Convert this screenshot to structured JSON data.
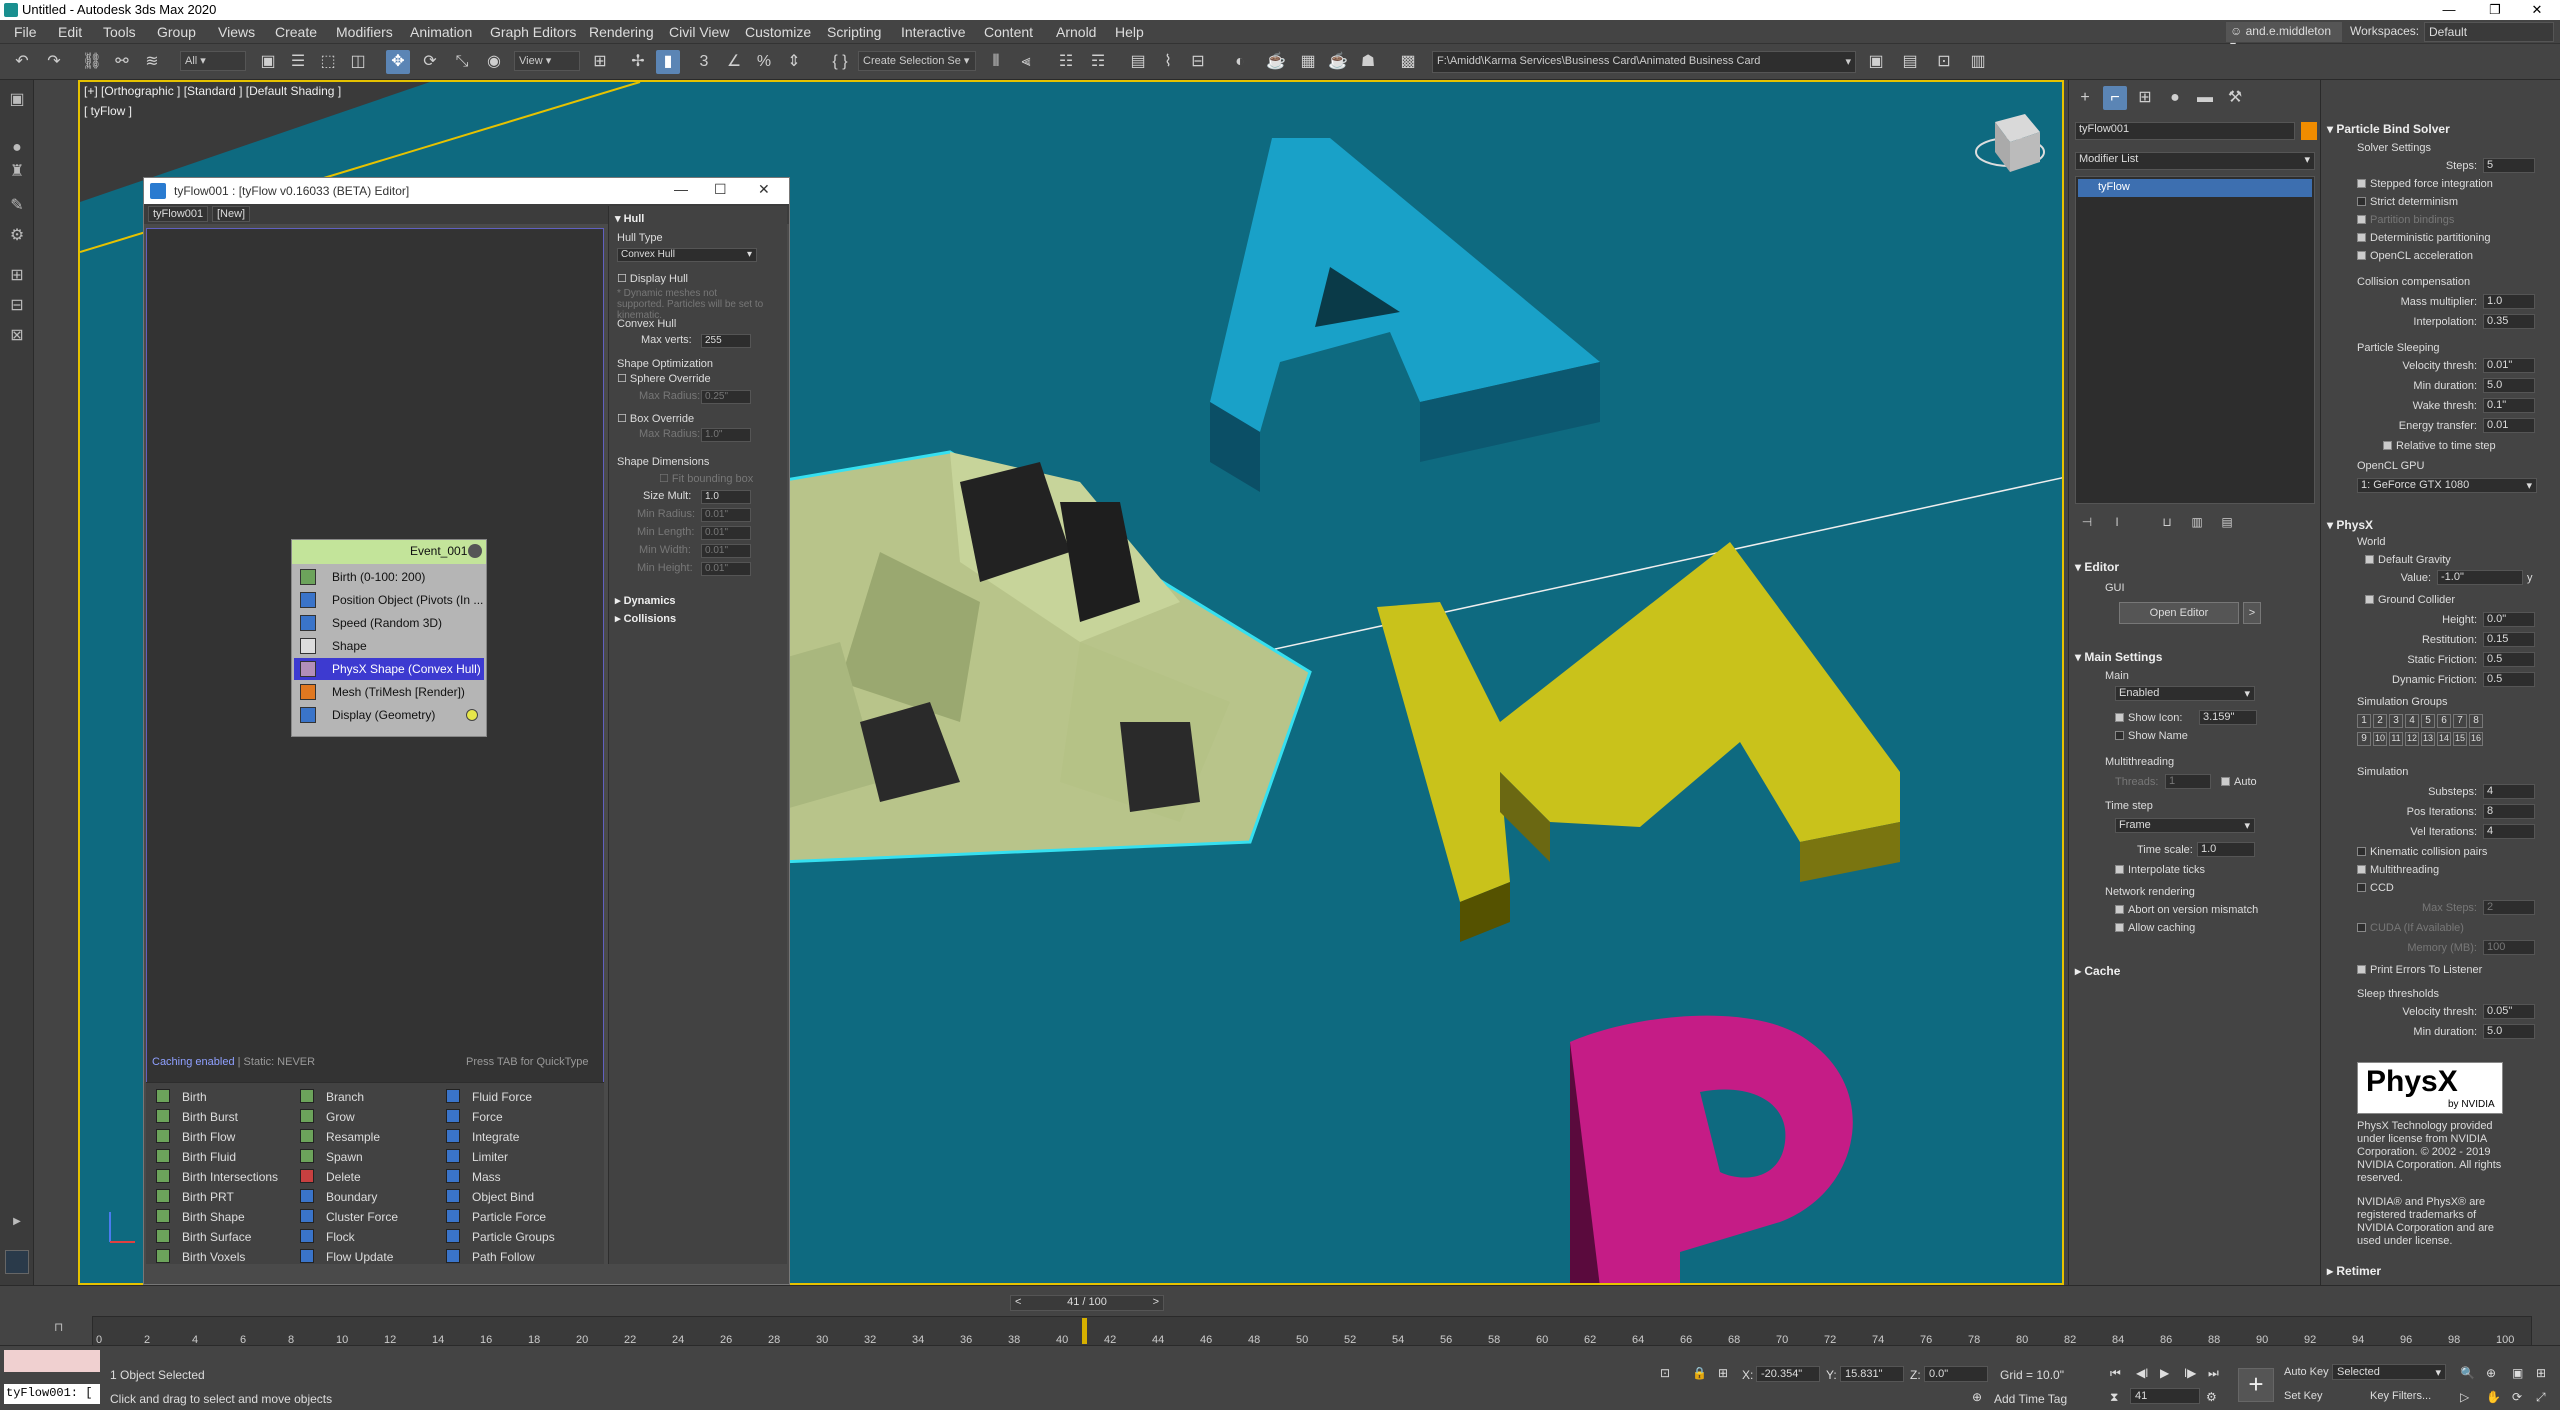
{
  "window": {
    "title": "Untitled - Autodesk 3ds Max 2020",
    "min": "—",
    "max": "❐",
    "close": "✕"
  },
  "menu": [
    "File",
    "Edit",
    "Tools",
    "Group",
    "Views",
    "Create",
    "Modifiers",
    "Animation",
    "Graph Editors",
    "Rendering",
    "Civil View",
    "Customize",
    "Scripting",
    "Interactive",
    "Content",
    "Arnold",
    "Help"
  ],
  "user": "and.e.middleton",
  "workspaces_label": "Workspaces:",
  "workspaces_value": "Default",
  "toolbar": {
    "selection_filter": "All",
    "ref_coord": "View",
    "named_selection": "Create Selection Se",
    "project_path": "F:\\Amidd\\Karma Services\\Business Card\\Animated Business Card"
  },
  "viewport": {
    "label": "[+] [Orthographic ] [Standard ] [Default Shading ]",
    "object_label": "[ tyFlow ]",
    "letters": [
      "A",
      "M",
      "P"
    ]
  },
  "editor": {
    "title": "tyFlow001 : [tyFlow v0.16033 (BETA) Editor]",
    "tabs": [
      "tyFlow001",
      "[New]"
    ],
    "status_left": "Caching enabled",
    "status_static": "| Static: NEVER",
    "status_right": "Press TAB for QuickType",
    "event": {
      "name": "Event_001",
      "operators": [
        "Birth (0-100: 200)",
        "Position Object (Pivots (In ...",
        "Speed (Random 3D)",
        "Shape",
        "PhysX Shape (Convex Hull)",
        "Mesh (TriMesh [Render])",
        "Display (Geometry)"
      ],
      "selected_index": 4
    },
    "hull": {
      "header": "Hull",
      "hull_type_label": "Hull Type",
      "hull_type_value": "Convex Hull",
      "display_hull": "Display Hull",
      "note": "* Dynamic meshes not supported. Particles will be set to kinematic.",
      "convex_hull_label": "Convex Hull",
      "max_verts_label": "Max verts:",
      "max_verts_value": "255",
      "shape_opt_label": "Shape Optimization",
      "sphere_override": "Sphere Override",
      "max_radius_label": "Max Radius:",
      "max_radius_value": "0.25\"",
      "box_override": "Box Override",
      "max_radius2_value": "1.0\"",
      "shape_dims_label": "Shape Dimensions",
      "fit_bbox": "Fit bounding box",
      "size_mult_label": "Size Mult:",
      "size_mult_value": "1.0",
      "min_radius_label": "Min Radius:",
      "min_radius_value": "0.01\"",
      "min_length_label": "Min Length:",
      "min_length_value": "0.01\"",
      "min_width_label": "Min Width:",
      "min_width_value": "0.01\"",
      "min_height_label": "Min Height:",
      "min_height_value": "0.01\"",
      "dynamics": "Dynamics",
      "collisions": "Collisions"
    },
    "palette": [
      [
        "Birth",
        "Branch",
        "Fluid Force"
      ],
      [
        "Birth Burst",
        "Grow",
        "Force"
      ],
      [
        "Birth Flow",
        "Resample",
        "Integrate"
      ],
      [
        "Birth Fluid",
        "Spawn",
        "Limiter"
      ],
      [
        "Birth Intersections",
        "Delete",
        "Mass"
      ],
      [
        "Birth PRT",
        "Boundary",
        "Object Bind"
      ],
      [
        "Birth Shape",
        "Cluster Force",
        "Particle Force"
      ],
      [
        "Birth Surface",
        "Flock",
        "Particle Groups"
      ],
      [
        "Birth Voxels",
        "Flow Update",
        "Path Follow"
      ]
    ]
  },
  "command_panel": {
    "object_name": "tyFlow001",
    "modifier_list": "Modifier List",
    "stack_item": "tyFlow",
    "editor_header": "Editor",
    "gui_label": "GUI",
    "open_editor": "Open Editor",
    "open_arrow": ">",
    "main_settings": "Main Settings",
    "main_label": "Main",
    "enabled_value": "Enabled",
    "show_icon": "Show Icon:",
    "show_icon_value": "3.159\"",
    "show_name": "Show Name",
    "multithreading_label": "Multithreading",
    "threads_label": "Threads:",
    "threads_value": "1",
    "auto": "Auto",
    "time_step_label": "Time step",
    "time_step_value": "Frame",
    "time_scale_label": "Time scale:",
    "time_scale_value": "1.0",
    "interpolate_ticks": "Interpolate ticks",
    "network_rendering_label": "Network rendering",
    "abort_mismatch": "Abort on version mismatch",
    "allow_caching": "Allow caching",
    "cache_header": "Cache"
  },
  "solver": {
    "header": "Particle Bind Solver",
    "solver_settings": "Solver Settings",
    "steps_label": "Steps:",
    "steps_value": "5",
    "stepped_force": "Stepped force integration",
    "strict_det": "Strict determinism",
    "partition_bindings": "Partition bindings",
    "det_partitioning": "Deterministic partitioning",
    "opencl_accel": "OpenCL acceleration",
    "collision_comp": "Collision compensation",
    "mass_mult_label": "Mass multiplier:",
    "mass_mult_value": "1.0",
    "interp_label": "Interpolation:",
    "interp_value": "0.35",
    "sleeping": "Particle Sleeping",
    "vel_thresh_label": "Velocity thresh:",
    "vel_thresh_value": "0.01\"",
    "min_dur_label": "Min duration:",
    "min_dur_value": "5.0",
    "wake_thresh_label": "Wake thresh:",
    "wake_thresh_value": "0.1\"",
    "energy_label": "Energy transfer:",
    "energy_value": "0.01",
    "relative_time": "Relative to time step",
    "opencl_gpu": "OpenCL GPU",
    "gpu_value": "1: GeForce GTX 1080"
  },
  "physx": {
    "header": "PhysX",
    "world": "World",
    "default_gravity": "Default Gravity",
    "value_label": "Value:",
    "value_value": "-1.0\"",
    "value_axis": "y",
    "ground_collider": "Ground Collider",
    "height_label": "Height:",
    "height_value": "0.0\"",
    "restitution_label": "Restitution:",
    "restitution_value": "0.15",
    "static_fr_label": "Static Friction:",
    "static_fr_value": "0.5",
    "dynamic_fr_label": "Dynamic Friction:",
    "dynamic_fr_value": "0.5",
    "sim_groups": "Simulation Groups",
    "groups": [
      "1",
      "2",
      "3",
      "4",
      "5",
      "6",
      "7",
      "8",
      "9",
      "10",
      "11",
      "12",
      "13",
      "14",
      "15",
      "16"
    ],
    "simulation": "Simulation",
    "substeps_label": "Substeps:",
    "substeps_value": "4",
    "pos_iter_label": "Pos Iterations:",
    "pos_iter_value": "8",
    "vel_iter_label": "Vel Iterations:",
    "vel_iter_value": "4",
    "kinematic_pairs": "Kinematic collision pairs",
    "multithreading": "Multithreading",
    "ccd": "CCD",
    "max_steps_label": "Max Steps:",
    "max_steps_value": "2",
    "cuda": "CUDA (If Available)",
    "memory_label": "Memory (MB):",
    "memory_value": "100",
    "print_errors": "Print Errors To Listener",
    "sleep_thresholds": "Sleep thresholds",
    "sleep_vel_label": "Velocity thresh:",
    "sleep_vel_value": "0.05\"",
    "sleep_min_label": "Min duration:",
    "sleep_min_value": "5.0",
    "logo_main": "PhysX",
    "logo_sub": "by NVIDIA",
    "license1": "PhysX Technology provided under license from NVIDIA Corporation. © 2002 - 2019 NVIDIA Corporation. All rights reserved.",
    "license2": "NVIDIA® and PhysX® are registered trademarks of NVIDIA Corporation and are used under license.",
    "retimer": "Retimer"
  },
  "timeline": {
    "frame_display": "41 / 100",
    "prev": "<",
    "next": ">",
    "ticks": [
      "0",
      "2",
      "4",
      "6",
      "8",
      "10",
      "12",
      "14",
      "16",
      "18",
      "20",
      "22",
      "24",
      "26",
      "28",
      "30",
      "32",
      "34",
      "36",
      "38",
      "40",
      "42",
      "44",
      "46",
      "48",
      "50",
      "52",
      "54",
      "56",
      "58",
      "60",
      "62",
      "64",
      "66",
      "68",
      "70",
      "72",
      "74",
      "76",
      "78",
      "80",
      "82",
      "84",
      "86",
      "88",
      "90",
      "92",
      "94",
      "96",
      "98",
      "100"
    ],
    "current_frame": 41,
    "total_frames": 100
  },
  "status": {
    "script_text": "tyFlow001: [",
    "selected": "1 Object Selected",
    "prompt": "Click and drag to select and move objects",
    "x_label": "X:",
    "x_value": "-20.354\"",
    "y_label": "Y:",
    "y_value": "15.831\"",
    "z_label": "Z:",
    "z_value": "0.0\"",
    "grid": "Grid = 10.0\"",
    "add_time_tag": "Add Time Tag",
    "auto_key": "Auto Key",
    "set_key": "Set Key",
    "selected_dd": "Selected",
    "key_filters": "Key Filters...",
    "frame_field": "41"
  }
}
